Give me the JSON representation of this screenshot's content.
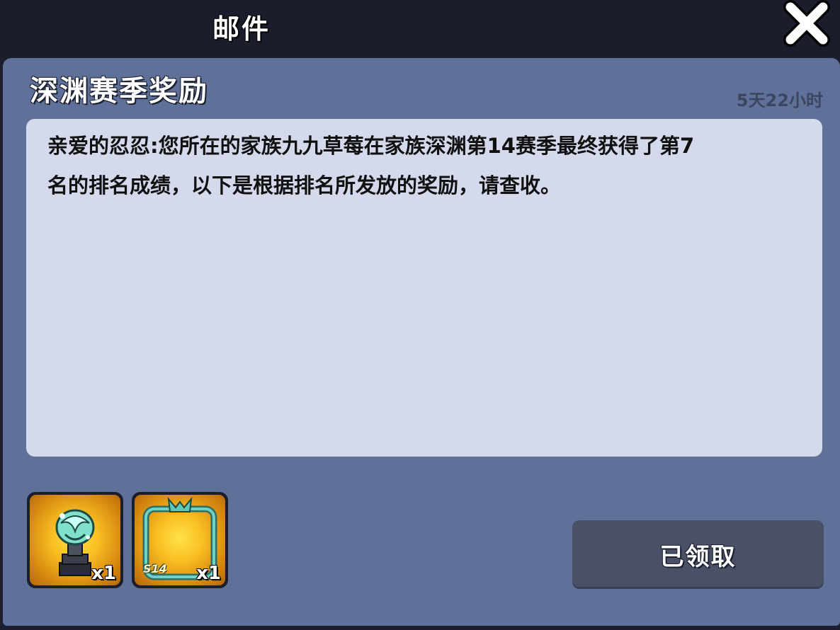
{
  "header": {
    "title": "邮件",
    "close_icon": "close-icon"
  },
  "mail": {
    "title": "深渊赛季奖励",
    "timer": "5天22小时",
    "body_line1": "亲爱的忍忍:您所在的家族九九草莓在家族深渊第14赛季最终获得了第7",
    "body_line2": "名的排名成绩，以下是根据排名所发放的奖励，请查收。"
  },
  "rewards": [
    {
      "icon": "trophy-statue-icon",
      "count": "x1"
    },
    {
      "icon": "avatar-frame-icon",
      "tag": "S14",
      "count": "x1"
    }
  ],
  "actions": {
    "claimed_label": "已领取"
  },
  "colors": {
    "panel": "#5f7099",
    "content_bg": "#d4d9ec",
    "header_bg": "#1a1d2c",
    "button_disabled": "#4a5065"
  }
}
